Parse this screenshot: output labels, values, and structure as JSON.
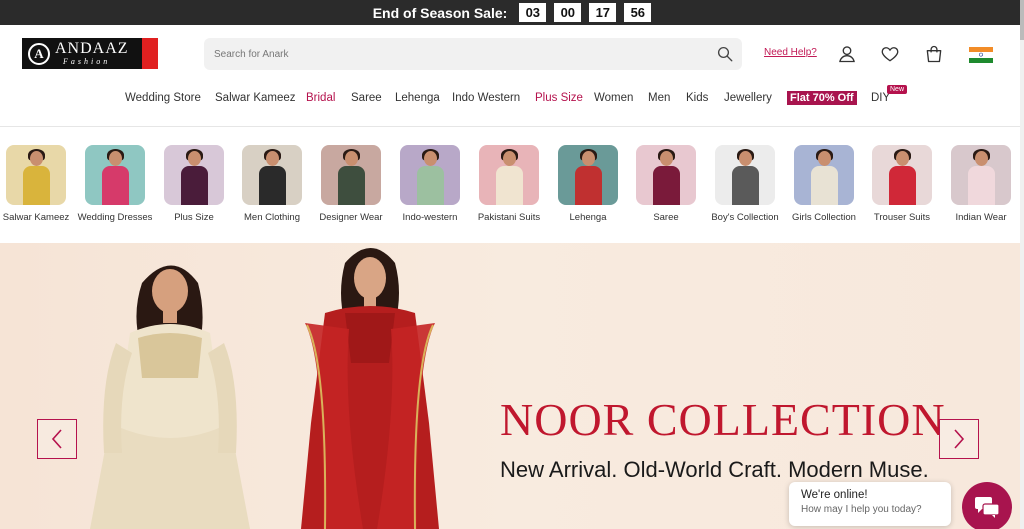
{
  "sale_bar": {
    "label": "End of Season Sale:",
    "timer": [
      "03",
      "00",
      "17",
      "56"
    ]
  },
  "header": {
    "logo_name": "ANDAAZ",
    "logo_sub": "Fashion",
    "logo_letter": "A",
    "search_placeholder": "Search for Anark",
    "need_help": "Need Help?"
  },
  "nav": [
    {
      "label": "Wedding Store",
      "style": "normal"
    },
    {
      "label": "Salwar Kameez",
      "style": "normal"
    },
    {
      "label": "Bridal",
      "style": "pink"
    },
    {
      "label": "Saree",
      "style": "normal"
    },
    {
      "label": "Lehenga",
      "style": "normal"
    },
    {
      "label": "Indo Western",
      "style": "normal"
    },
    {
      "label": "Plus Size",
      "style": "pink"
    },
    {
      "label": "Women",
      "style": "normal"
    },
    {
      "label": "Men",
      "style": "normal"
    },
    {
      "label": "Kids",
      "style": "normal"
    },
    {
      "label": "Jewellery",
      "style": "normal"
    },
    {
      "label": "Flat 70% Off",
      "style": "flat"
    },
    {
      "label": "DIY",
      "style": "normal"
    }
  ],
  "new_badge": "New",
  "categories": [
    {
      "label": "Salwar Kameez",
      "color": "#d9b43c",
      "bg": "#e8d8a8"
    },
    {
      "label": "Wedding Dresses",
      "color": "#d63a6a",
      "bg": "#8fc7c2"
    },
    {
      "label": "Plus Size",
      "color": "#4a1c3a",
      "bg": "#d8c8d8"
    },
    {
      "label": "Men Clothing",
      "color": "#2a2a2a",
      "bg": "#d8d0c4"
    },
    {
      "label": "Designer Wear",
      "color": "#3e4e3e",
      "bg": "#c8a8a0"
    },
    {
      "label": "Indo-western",
      "color": "#9cc0a0",
      "bg": "#b8a8c8"
    },
    {
      "label": "Pakistani Suits",
      "color": "#f0e4d0",
      "bg": "#e8b4b8"
    },
    {
      "label": "Lehenga",
      "color": "#c03030",
      "bg": "#6a9a98"
    },
    {
      "label": "Saree",
      "color": "#7a1a3a",
      "bg": "#e8c8d0"
    },
    {
      "label": "Boy's Collection",
      "color": "#5a5a5a",
      "bg": "#ececec"
    },
    {
      "label": "Girls Collection",
      "color": "#e8e2d4",
      "bg": "#a8b4d4"
    },
    {
      "label": "Trouser Suits",
      "color": "#d02838",
      "bg": "#e8d8d8"
    },
    {
      "label": "Indian Wear",
      "color": "#f0d8dc",
      "bg": "#d8c8cc"
    }
  ],
  "hero": {
    "title": "NOOR COLLECTION",
    "subtitle": "New Arrival. Old-World Craft. Modern Muse."
  },
  "chat": {
    "title": "We're online!",
    "subtitle": "How may I help you today?"
  },
  "colors": {
    "accent": "#b5124d",
    "sale_bar": "#2b2b2b",
    "hero_title": "#c0172e"
  }
}
